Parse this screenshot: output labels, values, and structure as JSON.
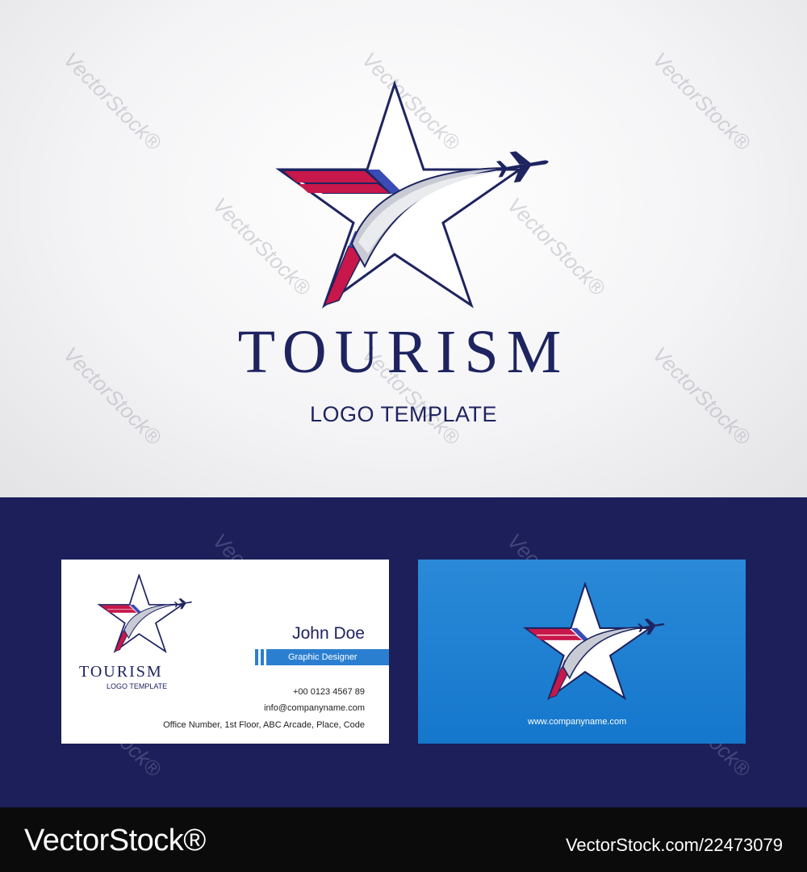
{
  "logo": {
    "title": "TOURISM",
    "subtitle": "LOGO TEMPLATE",
    "icon": "star-airplane-swoosh-icon"
  },
  "watermark": {
    "text": "VectorStock®"
  },
  "card_front": {
    "title": "TOURISM",
    "subtitle": "LOGO TEMPLATE",
    "name": "John Doe",
    "role": "Graphic Designer",
    "phone": "+00 0123 4567 89",
    "email": "info@companyname.com",
    "address": "Office Number, 1st Floor, ABC Arcade, Place, Code"
  },
  "card_back": {
    "website": "www.companyname.com"
  },
  "footer": {
    "brand": "VectorStock",
    "brand_mark": "®",
    "image_id": "VectorStock.com/22473079"
  },
  "colors": {
    "navy": "#1e2460",
    "dark_band": "#1c1f5a",
    "flag_red": "#c8174a",
    "flag_blue": "#3a4bb5",
    "card_blue": "#1b7acb"
  }
}
